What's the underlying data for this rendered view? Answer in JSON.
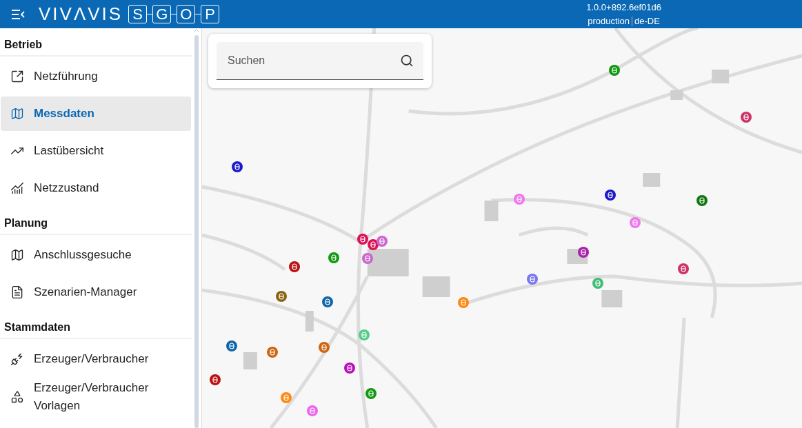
{
  "header": {
    "logo_text": "VIVΛVIS",
    "logo_letters": [
      "S",
      "G",
      "O",
      "P"
    ],
    "version": "1.0.0+892.6ef01d6",
    "environment": "production",
    "locale": "de-DE"
  },
  "sidebar": {
    "sections": [
      {
        "title": "Betrieb",
        "items": [
          {
            "label": "Netzführung",
            "selected": false
          },
          {
            "label": "Messdaten",
            "selected": true
          },
          {
            "label": "Lastübersicht",
            "selected": false
          },
          {
            "label": "Netzzustand",
            "selected": false
          }
        ]
      },
      {
        "title": "Planung",
        "items": [
          {
            "label": "Anschlussgesuche",
            "selected": false
          },
          {
            "label": "Szenarien-Manager",
            "selected": false
          }
        ]
      },
      {
        "title": "Stammdaten",
        "items": [
          {
            "label": "Erzeuger/Verbraucher",
            "selected": false
          },
          {
            "label": "Erzeuger/Verbraucher Vorlagen",
            "selected": false
          }
        ]
      }
    ]
  },
  "search": {
    "placeholder": "Suchen"
  },
  "map": {
    "markers": [
      {
        "color": "#119911"
      },
      {
        "color": "#cc3366"
      },
      {
        "color": "#1a1acc"
      },
      {
        "color": "#1a1acc"
      },
      {
        "color": "#ee77ee"
      },
      {
        "color": "#117711"
      },
      {
        "color": "#ee77ee"
      },
      {
        "color": "#dd1155"
      },
      {
        "color": "#dd1155"
      },
      {
        "color": "#cc66cc"
      },
      {
        "color": "#cc66cc"
      },
      {
        "color": "#119911"
      },
      {
        "color": "#bb1111"
      },
      {
        "color": "#aa22aa"
      },
      {
        "color": "#cc3366"
      },
      {
        "color": "#7777ee"
      },
      {
        "color": "#44bb77"
      },
      {
        "color": "#886611"
      },
      {
        "color": "#1166aa"
      },
      {
        "color": "#ff8811"
      },
      {
        "color": "#55cc88"
      },
      {
        "color": "#1166aa"
      },
      {
        "color": "#cc6611"
      },
      {
        "color": "#cc6611"
      },
      {
        "color": "#bb11bb"
      },
      {
        "color": "#119911"
      },
      {
        "color": "#bb1111"
      },
      {
        "color": "#ff8811"
      },
      {
        "color": "#ee66ee"
      }
    ]
  }
}
